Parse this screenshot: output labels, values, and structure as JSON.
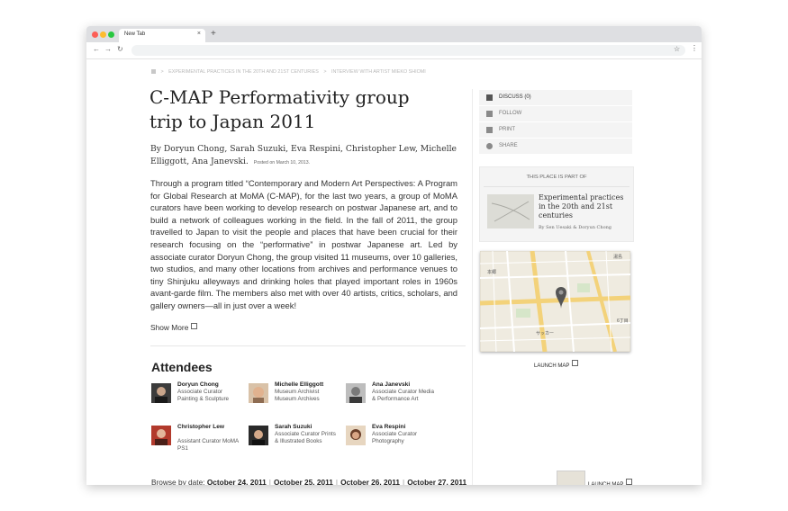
{
  "browser": {
    "tab_title": "New Tab",
    "tab_close": "×",
    "new_tab": "+",
    "back": "←",
    "forward": "→",
    "reload": "↻",
    "bookmark": "☆",
    "menu": "⋮"
  },
  "breadcrumb": {
    "separator": ">",
    "items": [
      "Experimental practices in the 20th and 21st centuries",
      "Interview with artist Mieko Shiomi"
    ]
  },
  "article": {
    "title": "C-MAP Performativity group trip to Japan 2011",
    "byline": "By Doryun Chong, Sarah Suzuki, Eva Respini, Christopher Lew, Michelle Elliggott, Ana Janevski.",
    "posted": "Posted on March 10, 2013.",
    "body": "Through a program titled “Contemporary and Modern Art Perspectives: A Program for Global Research at MoMA (C-MAP), for the last two years, a group of MoMA curators have been working to develop research on postwar Japanese art, and to build a network of colleagues working in the field. In the fall of 2011, the group travelled to Japan to visit the people and places that have been crucial for their research focusing on the “performative” in postwar Japanese art.  Led by associate curator Doryun Chong, the group visited 11 museums, over 10 galleries, two studios, and many other locations from archives and performance venues to tiny Shinjuku alleyways and drinking holes that played important roles in 1960s avant-garde film. The members also met with over 40 artists, critics, scholars, and gallery owners—all in just over a week!",
    "show_more": "Show More"
  },
  "attendees": {
    "heading": "Attendees",
    "people": [
      {
        "name": "Doryun Chong",
        "title": "Associate Curator Painting & Sculpture"
      },
      {
        "name": "Michelle Elliggott",
        "title": "Museum Archivist Museum Archives"
      },
      {
        "name": "Ana Janevski",
        "title": "Associate Curator Media & Performance Art"
      },
      {
        "name": "Christopher Lew",
        "title": "Assistant Curator MoMA PS1"
      },
      {
        "name": "Sarah Suzuki",
        "title": "Associate Curator Prints & Illustrated Books"
      },
      {
        "name": "Eva Respini",
        "title": "Associate Curator Photography"
      }
    ]
  },
  "browse": {
    "label": "Browse by date:",
    "sep": "|",
    "dates": [
      "October 24, 2011",
      "October 25, 2011",
      "October 26, 2011",
      "October 27, 2011"
    ]
  },
  "sidebar": {
    "actions": [
      "Discuss (0)",
      "Follow",
      "Print",
      "Share"
    ],
    "place_heading": "This place is part of",
    "place_title": "Experimental practices in the 20th and 21st centuries",
    "place_authors": "By Sen Uesaki & Doryun Chong",
    "launch_map": "Launch Map"
  },
  "map_labels": {
    "tr": "湯島",
    "r1": "6丁目",
    "mid": "サッカー",
    "tl": "本郷"
  },
  "colors": {
    "primary_text": "#222222",
    "sidebar_bg": "#f4f4f4",
    "map_bg": "#efebe0",
    "road_yellow": "#f3d27a",
    "map_pin": "#555555"
  }
}
